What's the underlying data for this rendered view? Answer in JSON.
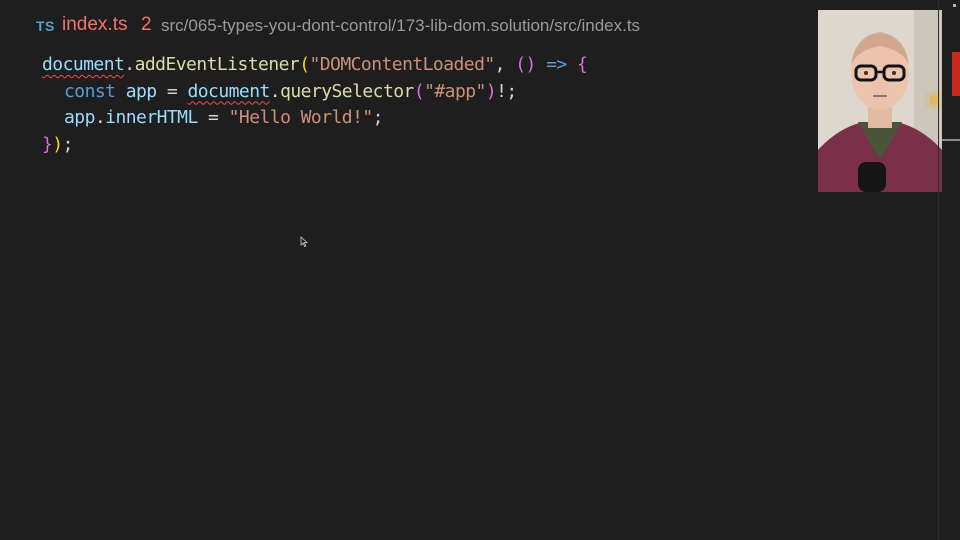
{
  "tab": {
    "language_badge": "TS",
    "file_name": "index.ts",
    "error_count": "2",
    "path": "src/065-types-you-dont-control/173-lib-dom.solution/src/index.ts"
  },
  "code": {
    "line1": {
      "obj": "document",
      "dot": ".",
      "method": "addEventListener",
      "open": "(",
      "arg": "\"DOMContentLoaded\"",
      "comma": ", ",
      "arrow_params": "()",
      "arrow": " => ",
      "brace": "{"
    },
    "line2": {
      "kw": "const",
      "name": "app",
      "eq": " = ",
      "obj": "document",
      "dot": ".",
      "method": "querySelector",
      "open": "(",
      "arg": "\"#app\"",
      "close": ")",
      "tail": "!;"
    },
    "line3": {
      "obj": "app",
      "dot": ".",
      "prop": "innerHTML",
      "eq": " = ",
      "val": "\"Hello World!\"",
      "semi": ";"
    },
    "line4": {
      "brace": "}",
      "paren": ")",
      "semi": ";"
    }
  },
  "colors": {
    "error": "#f0756e",
    "ts_badge": "#4fa0d6",
    "editor_bg": "#1e1e1e"
  },
  "icons": {
    "cursor": "mouse-pointer-icon",
    "language": "typescript-icon"
  }
}
